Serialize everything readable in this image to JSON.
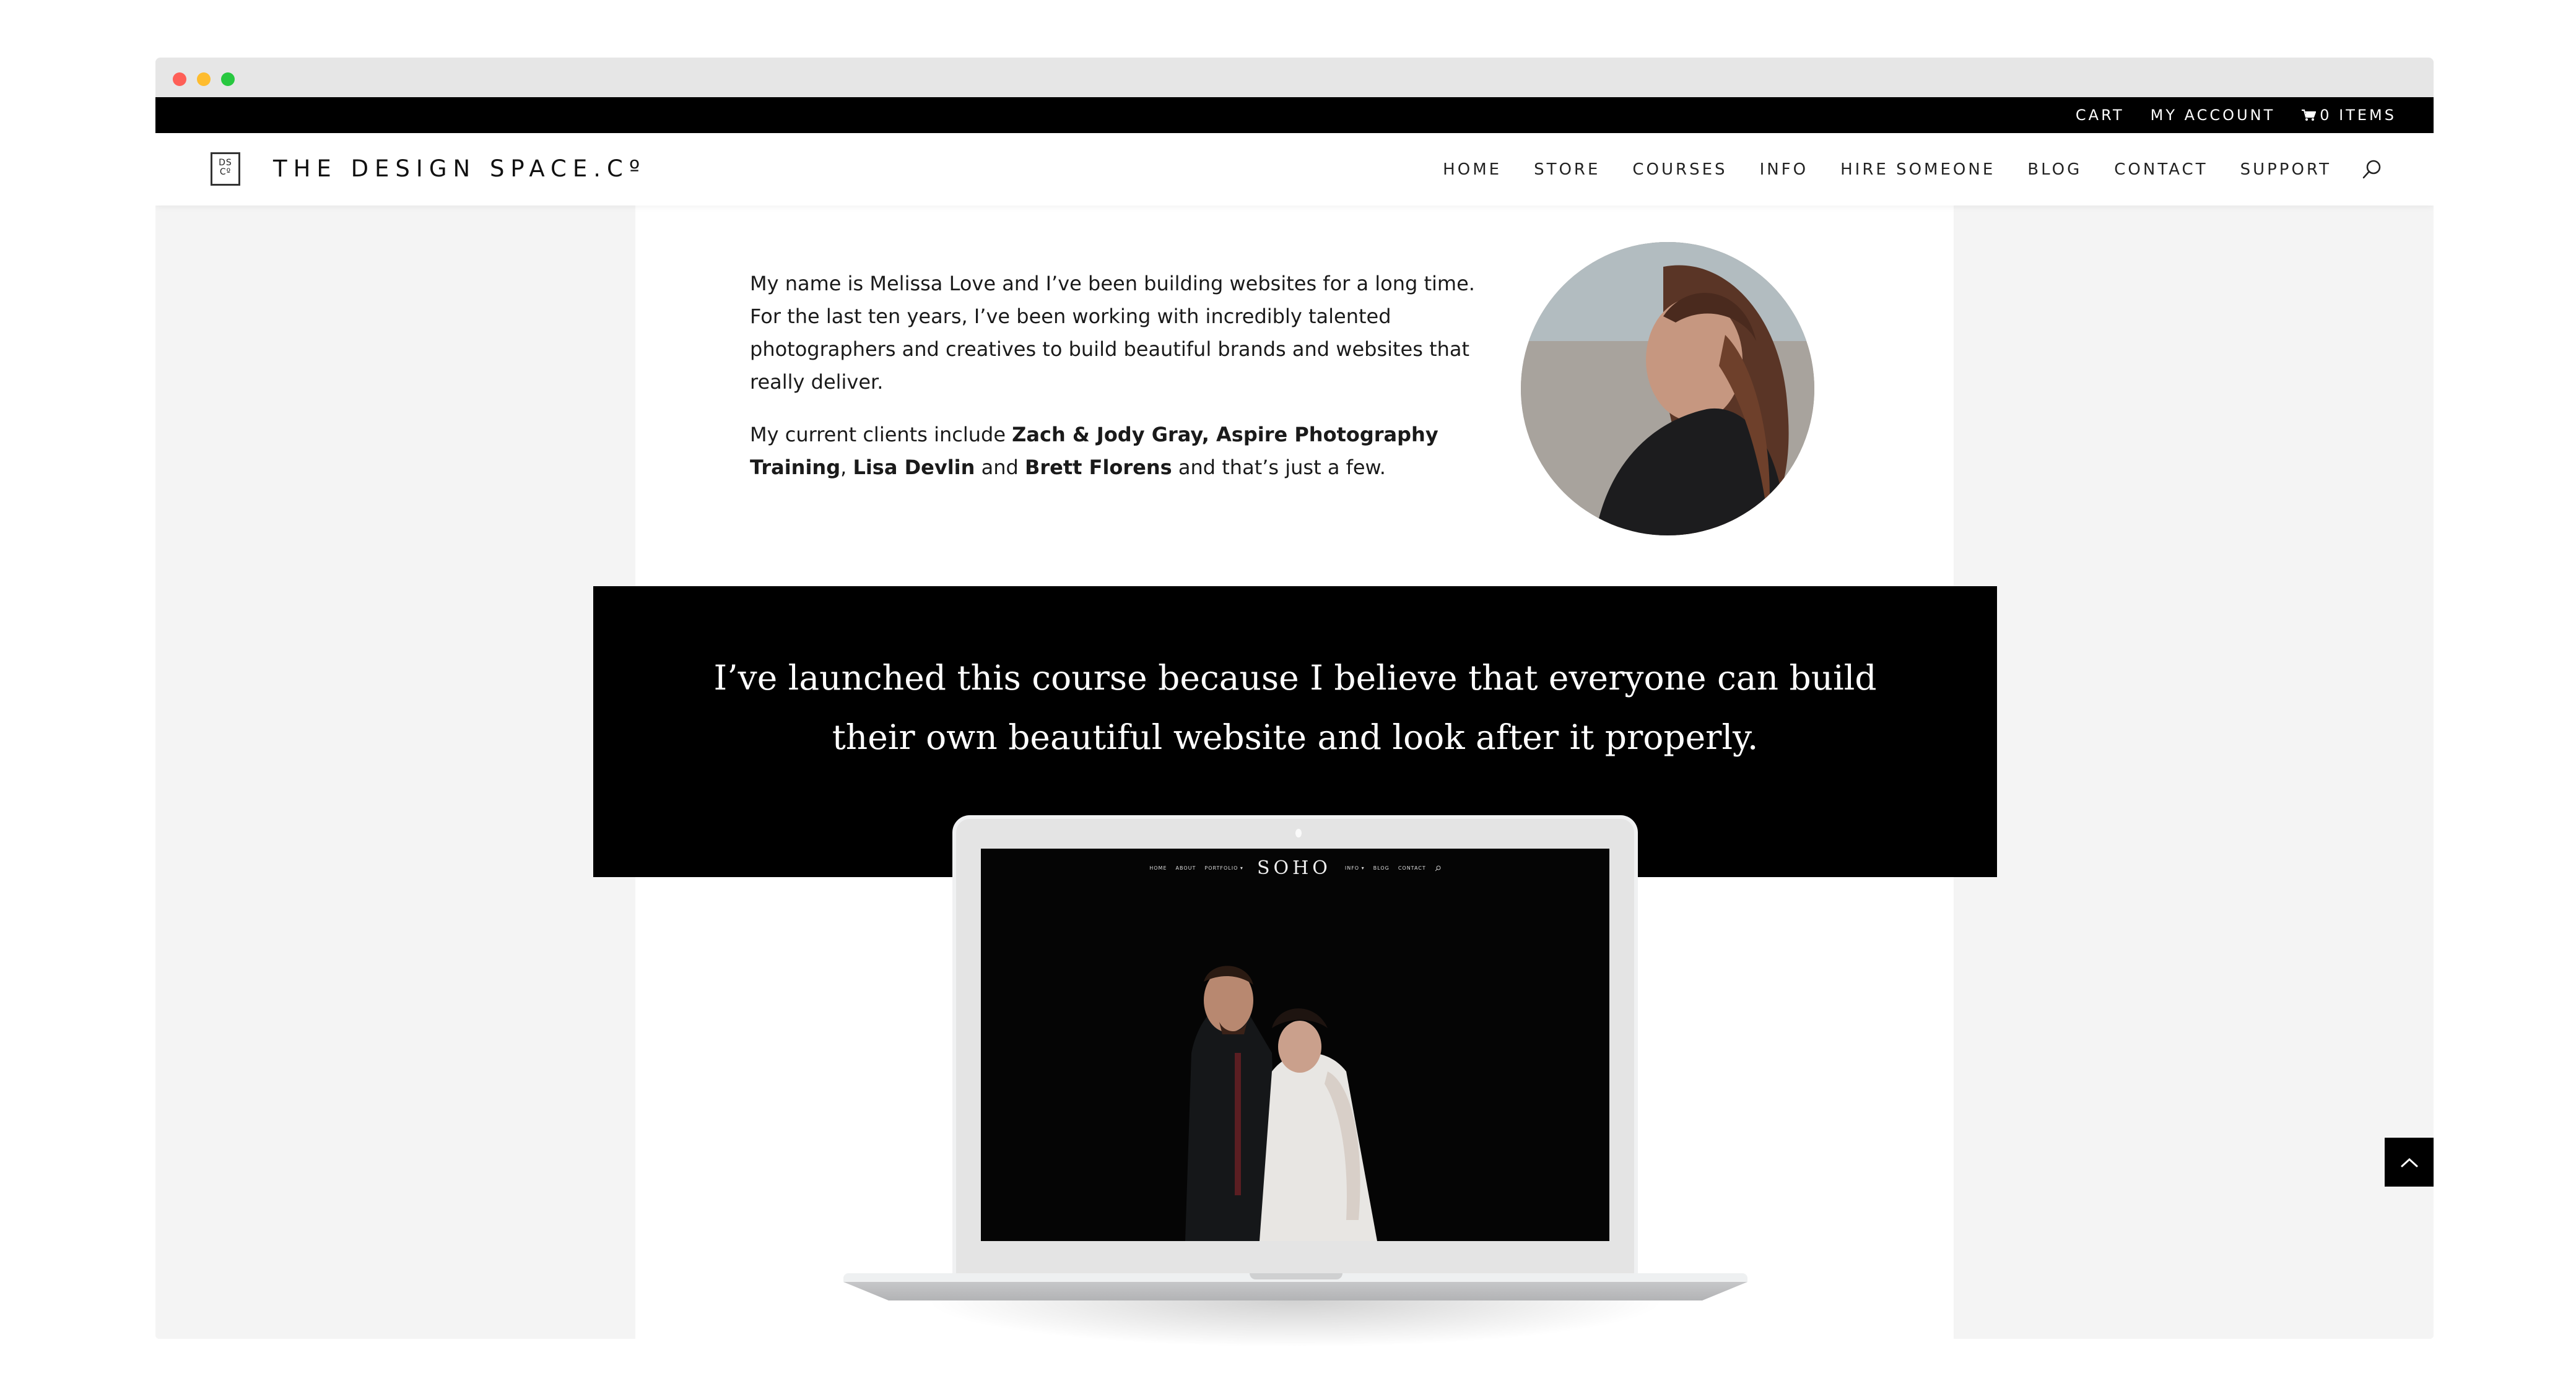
{
  "browser": {
    "window_controls": [
      "close",
      "minimize",
      "maximize"
    ]
  },
  "topbar": {
    "links": [
      {
        "label": "CART"
      },
      {
        "label": "MY ACCOUNT"
      },
      {
        "label": "0 ITEMS",
        "icon": "cart-icon"
      }
    ]
  },
  "header": {
    "logo_mark": "DS\nCO",
    "logo_mark_top": "DS",
    "logo_mark_bottom": "Cº",
    "brand": "THE DESIGN SPACE.Cº",
    "nav": [
      {
        "label": "HOME"
      },
      {
        "label": "STORE"
      },
      {
        "label": "COURSES"
      },
      {
        "label": "INFO"
      },
      {
        "label": "HIRE SOMEONE"
      },
      {
        "label": "BLOG"
      },
      {
        "label": "CONTACT"
      },
      {
        "label": "SUPPORT"
      }
    ],
    "search_icon": "search-icon"
  },
  "bio": {
    "paragraph1": "My name is Melissa Love and I’ve been building websites for a long time. For the last ten years, I’ve been working with incredibly talented photographers and creatives to build beautiful brands and websites that really deliver.",
    "p2_intro": "My current clients include ",
    "p2_client1": "Zach & Jody Gray, Aspire Photography Training",
    "p2_sep1": ", ",
    "p2_client2": "Lisa Devlin",
    "p2_and": " and ",
    "p2_client3": "Brett Florens",
    "p2_outro": " and that’s just a few.",
    "portrait_alt": "Portrait of Melissa Love"
  },
  "quote": {
    "line1": "I’ve launched this course because I believe that everyone can build",
    "line2": "their own beautiful website and look after it properly."
  },
  "laptop_mockup": {
    "site_nav_left": [
      "HOME",
      "ABOUT",
      "PORTFOLIO ▾"
    ],
    "site_brand": "SOHO",
    "site_nav_right": [
      "INFO ▾",
      "BLOG",
      "CONTACT"
    ],
    "photo_alt": "Couple portrait on dark background"
  },
  "scroll_top": {
    "icon": "chevron-up-icon"
  },
  "colors": {
    "topbar_bg": "#000000",
    "page_bg": "#f4f4f4",
    "column_bg": "#ffffff",
    "quote_bg": "#000000",
    "text": "#1a1a1a"
  }
}
